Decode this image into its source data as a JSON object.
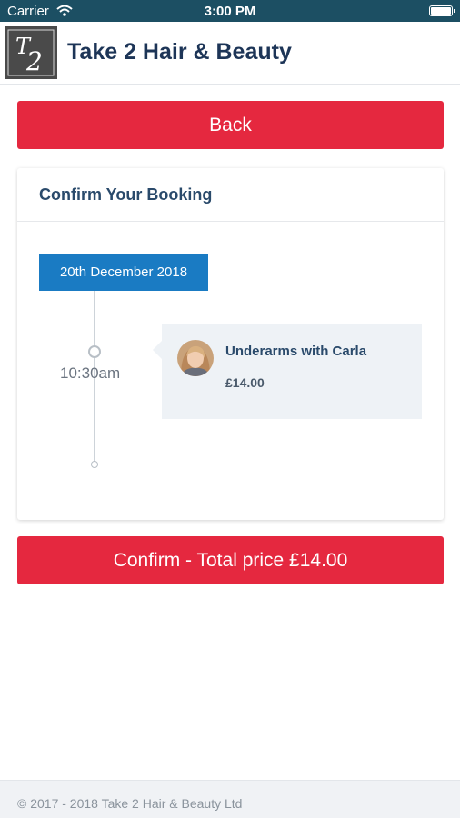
{
  "status_bar": {
    "carrier": "Carrier",
    "time": "3:00 PM",
    "wifi_icon": "wifi-icon",
    "battery_icon": "battery-icon"
  },
  "header": {
    "logo_text": "T2",
    "title": "Take 2 Hair & Beauty"
  },
  "back_button": {
    "label": "Back"
  },
  "booking_card": {
    "title": "Confirm Your Booking",
    "date": "20th December 2018",
    "time": "10:30am",
    "item": {
      "service": "Underarms with Carla",
      "price": "£14.00",
      "avatar_icon": "staff-avatar"
    }
  },
  "confirm_button": {
    "label": "Confirm - Total price £14.00"
  },
  "footer": {
    "copyright": "© 2017 - 2018 Take 2 Hair & Beauty Ltd"
  },
  "colors": {
    "status_bar": "#1c4f63",
    "accent_red": "#e5283f",
    "date_badge": "#1a7bc3",
    "title_navy": "#1d3557"
  }
}
